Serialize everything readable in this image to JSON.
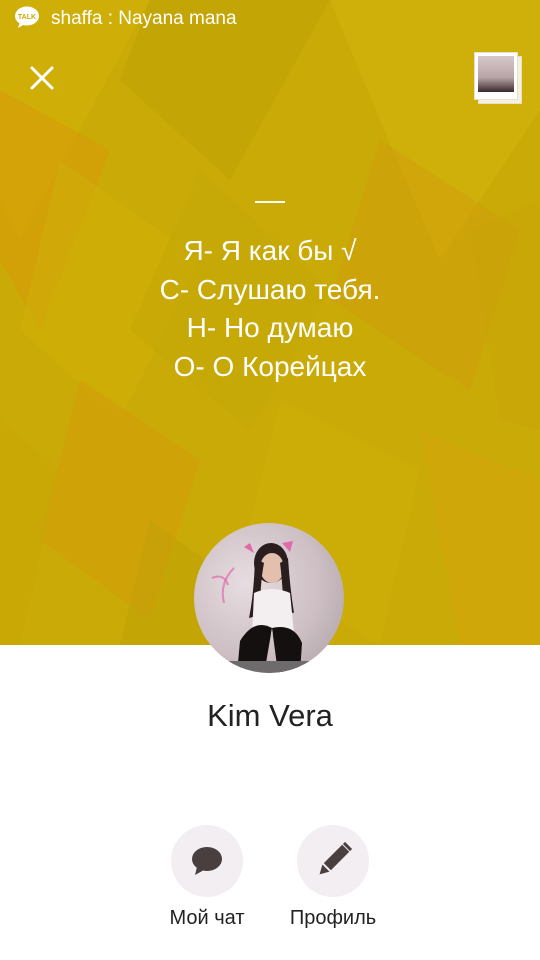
{
  "status_bar": {
    "app_icon": "kakao-talk-icon",
    "notification": "shaffa : Nayana mana"
  },
  "header": {
    "close_icon": "close-icon",
    "thumbnail_icon": "photo-stack-icon"
  },
  "status_message": {
    "lines": [
      "Я- Я как бы √",
      "С- Слушаю тебя.",
      "Н- Но думаю",
      "О- О Корейцах"
    ]
  },
  "profile": {
    "name": "Kim Vera"
  },
  "actions": [
    {
      "label": "Мой чат",
      "icon": "chat-bubble-icon"
    },
    {
      "label": "Профиль",
      "icon": "pencil-icon"
    }
  ],
  "colors": {
    "hero_background": "#c9aa06",
    "action_circle": "#f2eef2",
    "icon_dark": "#4a3f3f"
  }
}
